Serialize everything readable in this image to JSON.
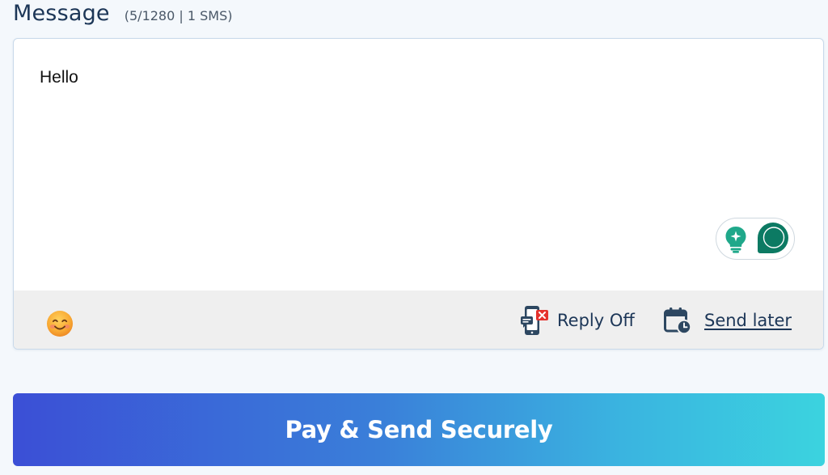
{
  "message": {
    "title": "Message",
    "counter": "(5/1280 | 1 SMS)",
    "text": "Hello"
  },
  "toolbar": {
    "emoji_icon": "smiling-face-icon",
    "reply_label": "Reply Off",
    "reply_icon": "phone-reply-off-icon",
    "send_later_label": "Send later",
    "send_later_icon": "calendar-clock-icon",
    "assist_icons": [
      "lightbulb-sparkle-icon",
      "toggle-icon"
    ]
  },
  "submit": {
    "label": "Pay & Send Securely"
  },
  "colors": {
    "title": "#1c3657",
    "accent_green": "#1fa88a",
    "toggle_dark": "#0c7a63",
    "button_gradient_start": "#3b4fd6",
    "button_gradient_end": "#3bd3df",
    "reply_off_badge": "#e5322d"
  }
}
